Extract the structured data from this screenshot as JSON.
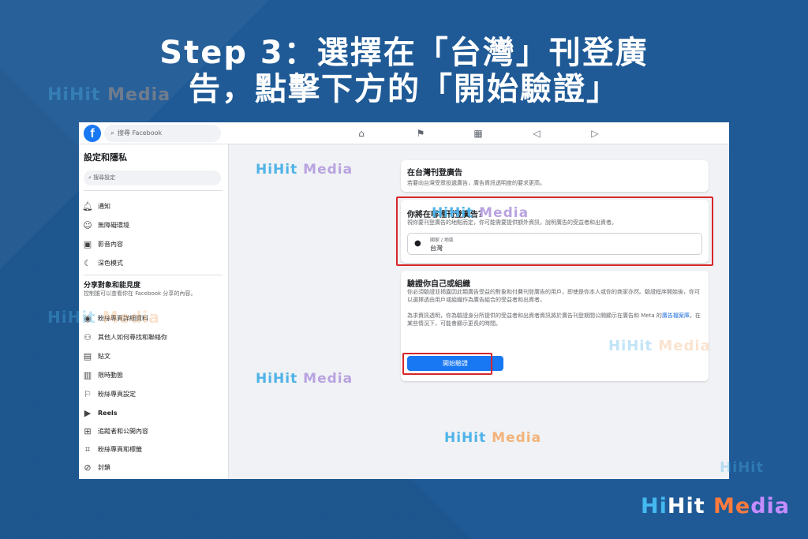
{
  "title": {
    "line1": "Step 3：選擇在「台灣」刊登廣",
    "line2": "告，點擊下方的「開始驗證」"
  },
  "watermark": {
    "part1": "HiHit",
    "part2": " Media"
  },
  "brand": {
    "a": "Hi",
    "b": "Hit",
    "c": " Me",
    "d": "dia"
  },
  "topbar": {
    "search_placeholder": "搜尋 Facebook",
    "logo_letter": "f",
    "nav_icons": [
      "home-icon",
      "flag-icon",
      "marketplace-icon",
      "megaphone-icon",
      "video-icon"
    ]
  },
  "sidebar": {
    "title": "設定和隱私",
    "search_placeholder": "搜尋設定",
    "items_top": [
      {
        "label": "通知",
        "icon": "bell-icon"
      },
      {
        "label": "無障礙環境",
        "icon": "accessibility-icon"
      },
      {
        "label": "影音內容",
        "icon": "media-icon"
      },
      {
        "label": "深色模式",
        "icon": "moon-icon"
      }
    ],
    "section_title": "分享對象和能見度",
    "section_desc": "控制誰可以查看你在 Facebook 分享的內容。",
    "items_bottom": [
      {
        "label": "粉絲專頁詳細資料",
        "icon": "profile-icon"
      },
      {
        "label": "其他人如何尋找和聯絡你",
        "icon": "people-icon"
      },
      {
        "label": "貼文",
        "icon": "post-icon"
      },
      {
        "label": "限時動態",
        "icon": "story-icon"
      },
      {
        "label": "粉絲專頁設定",
        "icon": "page-icon"
      },
      {
        "label": "Reels",
        "icon": "reels-icon"
      },
      {
        "label": "追蹤者和公開內容",
        "icon": "follower-icon"
      },
      {
        "label": "粉絲專頁和標籤",
        "icon": "tag-icon"
      },
      {
        "label": "封鎖",
        "icon": "block-icon"
      }
    ]
  },
  "main": {
    "card1": {
      "heading": "在台灣刊登廣告",
      "desc": "若要向台灣受眾投遞廣告，廣告資訊透明度的要求更高。"
    },
    "card2": {
      "heading": "你將在哪裡刊登廣告？",
      "desc": "視你要刊登廣告的地點而定，你可能需要提供額外資訊，說明廣告的受益者和出資者。",
      "field_label": "國家 / 地區",
      "field_value": "台灣"
    },
    "card3": {
      "heading": "驗證你自己或組織",
      "desc1": "你必須驗證並揭露因此類廣告受益的對象和付費刊登廣告的用戶，即使是你本人或你的商家亦然。驗證程序開始後，你可以選擇透由用戶或組織作為廣告組合的受益者和出資者。",
      "desc2_a": "為求資訊透明，你為驗證身分所提供的受益者和出資者資訊將於廣告刊登期間公開顯示在廣告和 Meta 的",
      "desc2_link": "廣告檔案庫",
      "desc2_b": "。在某些情況下，可能會顯示更長的時間。",
      "button": "開始驗證"
    }
  },
  "colors": {
    "background": "#1f5a96",
    "fb_blue": "#1877f2",
    "highlight_red": "#d8262a"
  }
}
